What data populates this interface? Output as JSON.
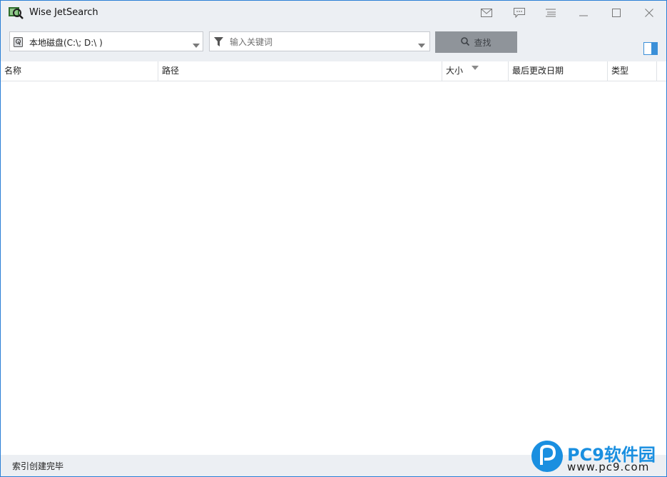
{
  "window": {
    "title": "Wise JetSearch"
  },
  "titlebar_buttons": [
    {
      "name": "mail-icon"
    },
    {
      "name": "feedback-icon"
    },
    {
      "name": "menu-icon"
    },
    {
      "name": "minimize-icon"
    },
    {
      "name": "maximize-icon"
    },
    {
      "name": "close-icon"
    }
  ],
  "toolbar": {
    "drive_select_value": "本地磁盘(C:\\; D:\\ )",
    "keyword_placeholder": "输入关键词",
    "search_label": "查找"
  },
  "table": {
    "columns": [
      "名称",
      "路径",
      "大小",
      "最后更改日期",
      "类型"
    ],
    "sorted_column": "大小",
    "rows": []
  },
  "status": {
    "text": "索引创建完毕"
  },
  "watermark": {
    "title": "PC9软件园",
    "url": "www.pc9.com"
  },
  "colors": {
    "accent": "#2b7fd6",
    "chrome": "#eceff3",
    "search_button": "#8f949a",
    "watermark": "#1a8fe0"
  }
}
